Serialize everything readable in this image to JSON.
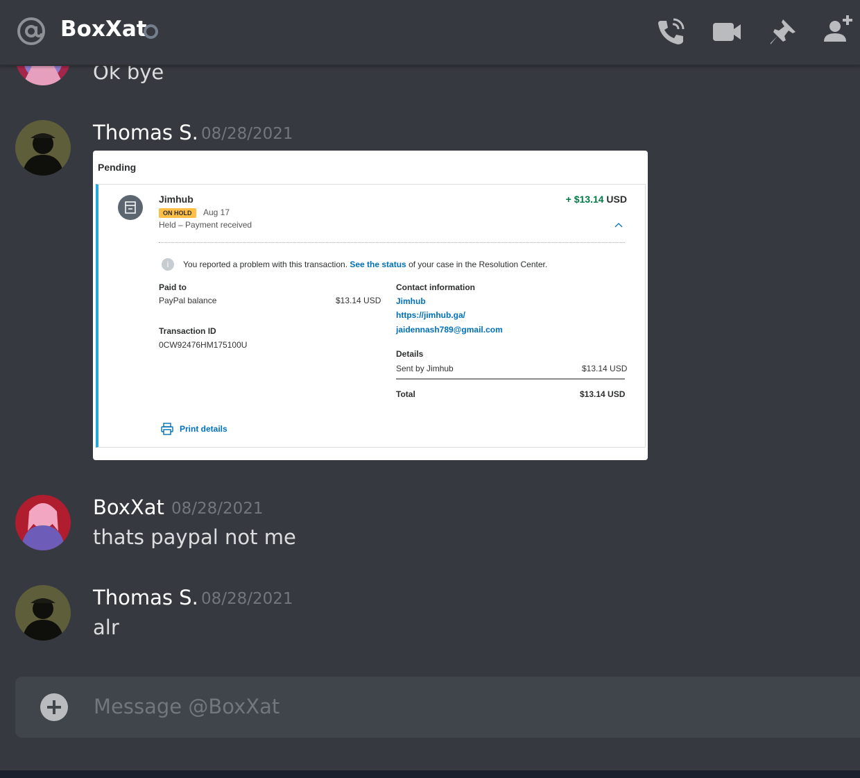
{
  "header": {
    "dm_name": "BoxXat",
    "icons": [
      "at-icon",
      "status-offline-icon",
      "voice-call-icon",
      "video-call-icon",
      "pinned-messages-icon",
      "add-friend-icon"
    ]
  },
  "messages": [
    {
      "text": "Ok bye"
    },
    {
      "author": "Thomas S.",
      "time": "08/28/2021"
    },
    {
      "author": "BoxXat",
      "time": "08/28/2021",
      "text": "thats paypal not me"
    },
    {
      "author": "Thomas S.",
      "time": "08/28/2021",
      "text": "alr"
    }
  ],
  "attachment": {
    "section": "Pending",
    "merchant": "Jimhub",
    "badge": "ON HOLD",
    "date": "Aug 17",
    "status": "Held – Payment received",
    "amount_sign": "+ $13.14",
    "amount_currency": " USD",
    "notice_pre": "You reported a problem with this transaction. ",
    "notice_link": "See the status",
    "notice_post": " of your case in the Resolution Center.",
    "paid_to_label": "Paid to",
    "paid_to_value": "PayPal balance",
    "paid_to_amount": "$13.14 USD",
    "txn_label": "Transaction ID",
    "txn_value": "0CW92476HM175100U",
    "contact_label": "Contact information",
    "contact_name": "Jimhub",
    "contact_url": "https://jimhub.ga/",
    "contact_email": "jaidennash789@gmail.com",
    "details_label": "Details",
    "sent_by": "Sent by Jimhub",
    "sent_amount": "$13.14 USD",
    "total_label": "Total",
    "total_amount": "$13.14 USD",
    "print_label": "Print details"
  },
  "composer": {
    "placeholder": "Message @BoxXat"
  },
  "colors": {
    "background": "#36393f",
    "composer": "#40444b",
    "paypal_blue": "#0070ba",
    "hold_badge": "#ffbe45",
    "amount_green": "#017a46"
  }
}
